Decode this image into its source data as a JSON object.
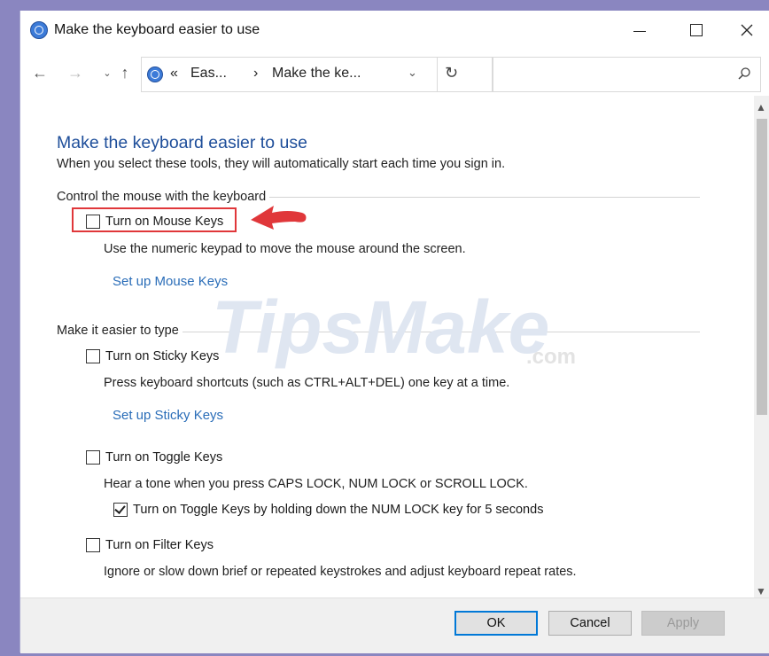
{
  "window": {
    "title": "Make the keyboard easier to use",
    "controls": {
      "minimize": "minimize-icon",
      "maximize": "maximize-icon",
      "close": "close-icon"
    }
  },
  "navigation": {
    "back": "←",
    "forward": "→",
    "recent": "⌄",
    "up": "↑",
    "breadcrumb_prefix": "«",
    "breadcrumb_parent": "Eas...",
    "breadcrumb_sep": "›",
    "breadcrumb_current": "Make the ke...",
    "dropdown": "⌄",
    "refresh": "↻",
    "search_placeholder": ""
  },
  "page": {
    "title": "Make the keyboard easier to use",
    "subtitle": "When you select these tools, they will automatically start each time you sign in."
  },
  "sections": {
    "mouse": {
      "heading": "Control the mouse with the keyboard",
      "mouse_keys": {
        "label": "Turn on Mouse Keys",
        "checked": false
      },
      "mouse_keys_desc": "Use the numeric keypad to move the mouse around the screen.",
      "setup_link": "Set up Mouse Keys"
    },
    "typing": {
      "heading": "Make it easier to type",
      "sticky_keys": {
        "label": "Turn on Sticky Keys",
        "checked": false
      },
      "sticky_desc": "Press keyboard shortcuts (such as CTRL+ALT+DEL) one key at a time.",
      "sticky_link": "Set up Sticky Keys",
      "toggle_keys": {
        "label": "Turn on Toggle Keys",
        "checked": false
      },
      "toggle_desc": "Hear a tone when you press CAPS LOCK, NUM LOCK or SCROLL LOCK.",
      "toggle_hold": {
        "label": "Turn on Toggle Keys by holding down the NUM LOCK key for 5 seconds",
        "checked": true
      },
      "filter_keys": {
        "label": "Turn on Filter Keys",
        "checked": false
      },
      "filter_desc": "Ignore or slow down brief or repeated keystrokes and adjust keyboard repeat rates."
    }
  },
  "watermark": {
    "brand": "TipsMake",
    "suffix": ".com"
  },
  "footer": {
    "ok": "OK",
    "cancel": "Cancel",
    "apply": "Apply"
  },
  "colors": {
    "accent": "#1e4e9a",
    "link": "#2a6db8",
    "highlight": "#e0373a"
  }
}
